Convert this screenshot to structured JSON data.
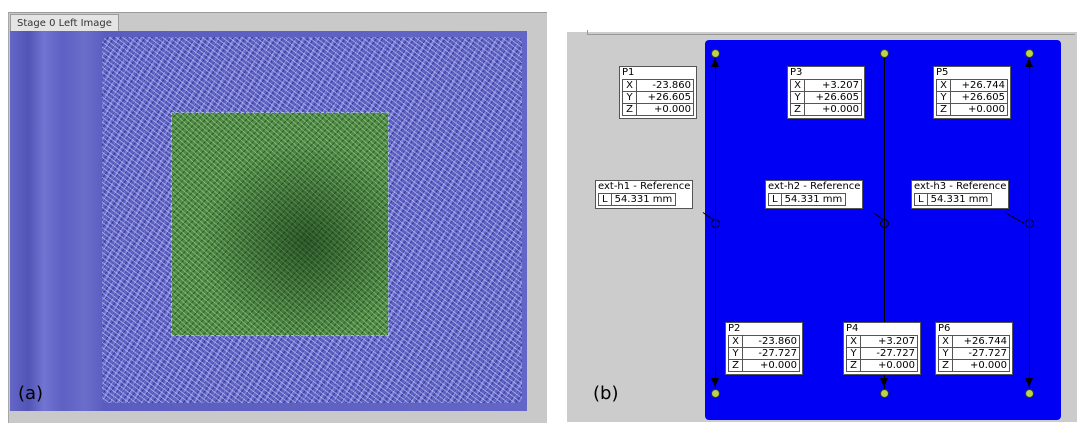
{
  "panel_a": {
    "tab_label": "Stage 0 Left Image",
    "caption": "(a)"
  },
  "panel_b": {
    "caption": "(b)",
    "points": [
      {
        "name": "P1",
        "x": "-23.860",
        "y": "+26.605",
        "z": "+0.000"
      },
      {
        "name": "P3",
        "x": "+3.207",
        "y": "+26.605",
        "z": "+0.000"
      },
      {
        "name": "P5",
        "x": "+26.744",
        "y": "+26.605",
        "z": "+0.000"
      },
      {
        "name": "P2",
        "x": "-23.860",
        "y": "-27.727",
        "z": "+0.000"
      },
      {
        "name": "P4",
        "x": "+3.207",
        "y": "-27.727",
        "z": "+0.000"
      },
      {
        "name": "P6",
        "x": "+26.744",
        "y": "-27.727",
        "z": "+0.000"
      }
    ],
    "references": [
      {
        "name": "ext-h1 - Reference",
        "length": "54.331 mm"
      },
      {
        "name": "ext-h2 - Reference",
        "length": "54.331 mm"
      },
      {
        "name": "ext-h3 - Reference",
        "length": "54.331 mm"
      }
    ],
    "axis_labels": {
      "x": "X",
      "y": "Y",
      "z": "Z",
      "length": "L"
    },
    "colors": {
      "plate": "#0000f5",
      "marker": "#b8d44a",
      "background": "#cccccc"
    }
  }
}
